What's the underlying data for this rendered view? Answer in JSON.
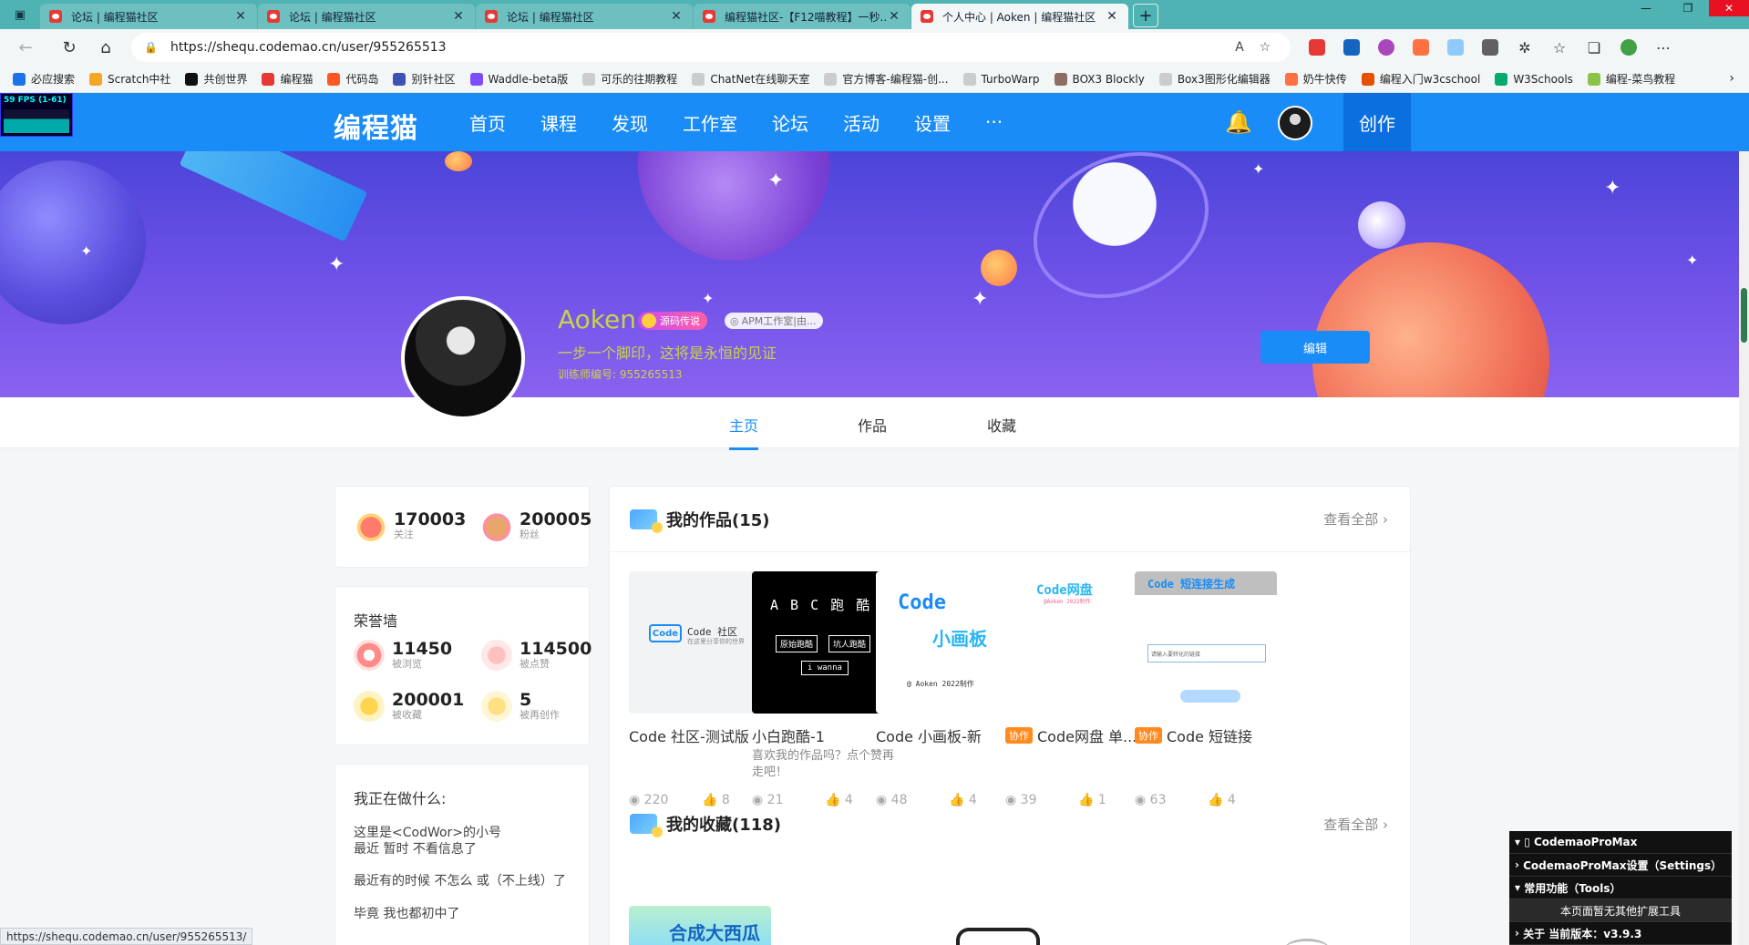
{
  "browser": {
    "tabs": [
      {
        "title": "论坛 | 编程猫社区"
      },
      {
        "title": "论坛 | 编程猫社区"
      },
      {
        "title": "论坛 | 编程猫社区"
      },
      {
        "title": "编程猫社区-【F12喵教程】一秒..."
      },
      {
        "title": "个人中心 | Aoken | 编程猫社区"
      }
    ],
    "url": "https://shequ.codemao.cn/user/955265513",
    "bookmarks": [
      {
        "label": "必应搜索",
        "color": "#1a73e8"
      },
      {
        "label": "Scratch中社",
        "color": "#f5a623"
      },
      {
        "label": "共创世界",
        "color": "#111111"
      },
      {
        "label": "编程猫",
        "color": "#e53935"
      },
      {
        "label": "代码岛",
        "color": "#ff5722"
      },
      {
        "label": "别针社区",
        "color": "#3f51b5"
      },
      {
        "label": "Waddle-beta版",
        "color": "#7c4dff"
      },
      {
        "label": "可乐的往期教程",
        "color": "#cccccc"
      },
      {
        "label": "ChatNet在线聊天室",
        "color": "#cccccc"
      },
      {
        "label": "官方博客-编程猫-创...",
        "color": "#cccccc"
      },
      {
        "label": "TurboWarp",
        "color": "#cccccc"
      },
      {
        "label": "BOX3 Blockly",
        "color": "#8d6e63"
      },
      {
        "label": "Box3图形化编辑器",
        "color": "#cccccc"
      },
      {
        "label": "奶牛快传",
        "color": "#ff7043"
      },
      {
        "label": "编程入门w3cschool",
        "color": "#e65100"
      },
      {
        "label": "W3Schools",
        "color": "#04aa6d"
      },
      {
        "label": "编程-菜鸟教程",
        "color": "#8bc34a"
      }
    ],
    "status_url": "https://shequ.codemao.cn/user/955265513/"
  },
  "fps": "59 FPS (1-61)",
  "header": {
    "logo": "编程猫",
    "nav": [
      "首页",
      "课程",
      "发现",
      "工作室",
      "论坛",
      "活动",
      "设置",
      "···"
    ],
    "create": "创作"
  },
  "profile": {
    "name": "Aoken",
    "badge": "源码传说",
    "studio": "APM工作室|由...",
    "motto": "一步一个脚印，这将是永恒的见证",
    "uid": "训练师编号: 955265513",
    "edit": "编辑"
  },
  "tabs": [
    "主页",
    "作品",
    "收藏"
  ],
  "follow": {
    "following": {
      "num": "170003",
      "label": "关注"
    },
    "fans": {
      "num": "200005",
      "label": "粉丝"
    }
  },
  "honor": {
    "title": "荣誉墙",
    "items": [
      {
        "num": "11450",
        "label": "被浏览",
        "color": "#ff8a8a"
      },
      {
        "num": "114500",
        "label": "被点赞",
        "color": "#ffc0c0"
      },
      {
        "num": "200001",
        "label": "被收藏",
        "color": "#ffd54f"
      },
      {
        "num": "5",
        "label": "被再创作",
        "color": "#ffe082"
      }
    ]
  },
  "doing": {
    "title": "我正在做什么:",
    "lines": [
      "这里是<CodWor>的小号",
      "最近 暂时 不看信息了",
      "最近有的时候 不怎么 或（不上线）了",
      "毕竟 我也都初中了"
    ]
  },
  "works": {
    "title": "我的作品(15)",
    "more": "查看全部",
    "items": [
      {
        "name": "Code 社区-测试版",
        "collab": "",
        "desc": "",
        "views": "220",
        "likes": "8",
        "thumb_title": "Code 社区",
        "thumb_sub": "在这里分享你的世界"
      },
      {
        "name": "小白跑酷-1",
        "collab": "",
        "desc": "喜欢我的作品吗？点个赞再走吧！",
        "views": "21",
        "likes": "4",
        "thumb_title": "A B C 跑 酷",
        "thumb_b1": "原始跑酷",
        "thumb_b2": "坑人跑酷",
        "thumb_b3": "i wanna"
      },
      {
        "name": "Code 小画板-新",
        "collab": "",
        "desc": "",
        "views": "48",
        "likes": "4",
        "thumb_title": "Code",
        "thumb_sub": "小画板",
        "thumb_foot": "@ Aoken 2022制作"
      },
      {
        "name": "Code网盘 单...",
        "collab": "协作",
        "desc": "",
        "views": "39",
        "likes": "1",
        "thumb_title": "Code网盘",
        "thumb_sub": "@Aoken 2022制作"
      },
      {
        "name": "Code 短链接",
        "collab": "协作",
        "desc": "",
        "views": "63",
        "likes": "4",
        "thumb_title": "Code 短连接生成",
        "thumb_input": "请输入要转化的链接"
      }
    ]
  },
  "favorites": {
    "title": "我的收藏(118)",
    "more": "查看全部",
    "first_thumb": "合成大西瓜"
  },
  "ext_panel": {
    "title": "▯ CodemaoProMax",
    "settings": "CodemaoProMax设置（Settings）",
    "tools": "常用功能（Tools）",
    "tools_note": "本页面暂无其他扩展工具",
    "about": "关于 当前版本：v3.9.3"
  }
}
